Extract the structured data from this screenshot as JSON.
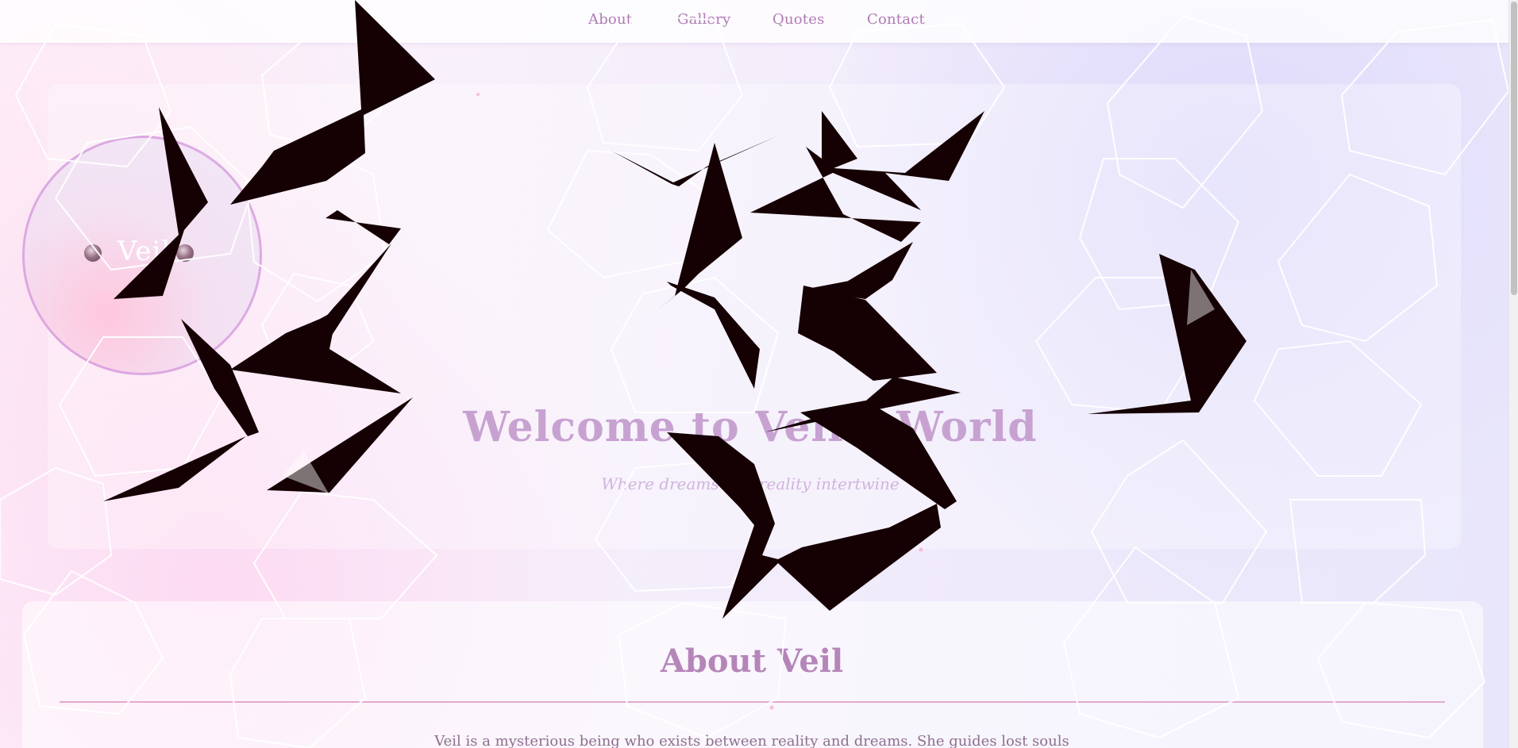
{
  "nav": {
    "items": [
      {
        "label": "About"
      },
      {
        "label": "Gallery"
      },
      {
        "label": "Quotes"
      },
      {
        "label": "Contact"
      }
    ]
  },
  "logo": {
    "text": "Veil"
  },
  "hero": {
    "title": "Welcome to Veil's World",
    "subtitle": "Where dreams and reality intertwine"
  },
  "about": {
    "title": "About Veil",
    "text": "Veil is a mysterious being who exists between reality and dreams. She guides lost souls"
  },
  "colors": {
    "accent": "#b585b9",
    "title": "#c7a2d1",
    "divider": "#e2a9cf",
    "shards": "#150003"
  }
}
